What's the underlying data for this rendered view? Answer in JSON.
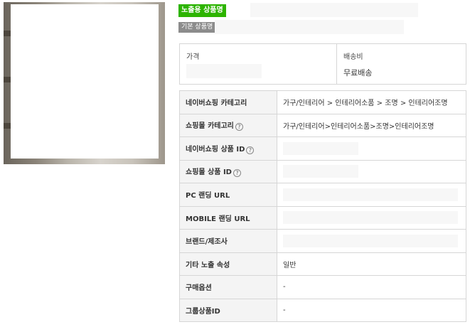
{
  "product": {
    "exposed_name_badge": "노출용 상품명",
    "basic_name_badge": "기본 상품명"
  },
  "pricing": {
    "price_label": "가격",
    "shipping_label": "배송비",
    "shipping_value": "무료배송"
  },
  "info_rows": [
    {
      "key": "네이버쇼핑 카테고리",
      "value": "가구/인테리어 > 인테리어소품 > 조명 > 인테리어조명"
    },
    {
      "key": "쇼핑몰 카테고리",
      "value": "가구/인테리어>인테리어소품>조명>인테리어조명"
    },
    {
      "key": "네이버쇼핑 상품 ID",
      "value": ""
    },
    {
      "key": "쇼핑몰 상품 ID",
      "value": ""
    },
    {
      "key": "PC 랜딩 URL",
      "value": ""
    },
    {
      "key": "MOBILE 랜딩 URL",
      "value": ""
    },
    {
      "key": "브랜드/제조사",
      "value": ""
    },
    {
      "key": "기타 노출 속성",
      "value": "일반"
    },
    {
      "key": "구매옵션",
      "value": "-"
    },
    {
      "key": "그룹상품ID",
      "value": "-"
    }
  ],
  "icons": {
    "help": "?"
  }
}
